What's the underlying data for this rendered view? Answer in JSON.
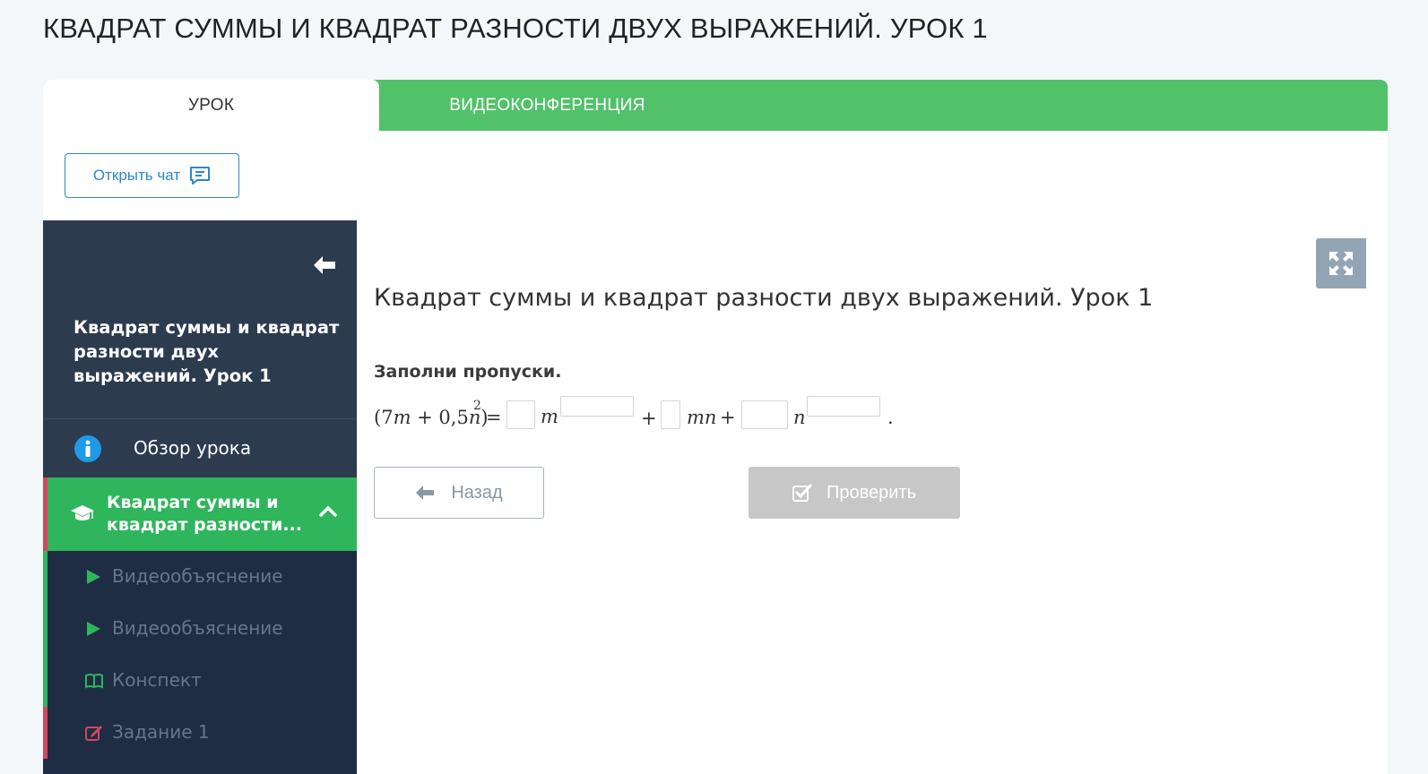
{
  "page": {
    "title": "КВАДРАТ СУММЫ И КВАДРАТ РАЗНОСТИ ДВУХ ВЫРАЖЕНИЙ. УРОК 1"
  },
  "tabs": {
    "lesson": "УРОК",
    "videoconf": "ВИДЕОКОНФЕРЕНЦИЯ"
  },
  "chat": {
    "label": "Открыть чат",
    "icon": "chat-bubble-icon"
  },
  "sidebar": {
    "title": "Квадрат суммы и квадрат разности двух выражений. Урок 1",
    "overview": {
      "label": "Обзор урока",
      "icon": "info-icon"
    },
    "section": {
      "label": "Квадрат суммы и квадрат разности...",
      "icon": "graduation-cap-icon",
      "expanded": true
    },
    "items": [
      {
        "label": "Видеообъяснение",
        "icon": "play-icon"
      },
      {
        "label": "Видеообъяснение",
        "icon": "play-icon"
      },
      {
        "label": "Конспект",
        "icon": "book-icon"
      },
      {
        "label": "Задание 1",
        "icon": "edit-icon"
      }
    ]
  },
  "content": {
    "title": "Квадрат суммы и квадрат разности двух выражений. Урок 1",
    "prompt": "Заполни пропуски.",
    "equation": {
      "lhs_open": "(7",
      "lhs_var_m": "m",
      "lhs_plus": " + 0,5",
      "lhs_var_n": "n",
      "lhs_close": ")",
      "lhs_exp": "2",
      "equals": "=",
      "var_m": "m",
      "plus1": "+",
      "var_mn": "mn",
      "plus2": "+",
      "var_n": "n",
      "period": ".",
      "blanks": [
        "",
        "",
        "",
        "",
        ""
      ]
    }
  },
  "buttons": {
    "back": "Назад",
    "check": "Проверить"
  },
  "colors": {
    "accent_green": "#51c26a",
    "sidebar_dark": "#1e2d44",
    "sidebar_head": "#2d3b4e",
    "active_section": "#2fb55c",
    "marker_red": "#d2475d",
    "link_blue": "#2c88c8"
  }
}
